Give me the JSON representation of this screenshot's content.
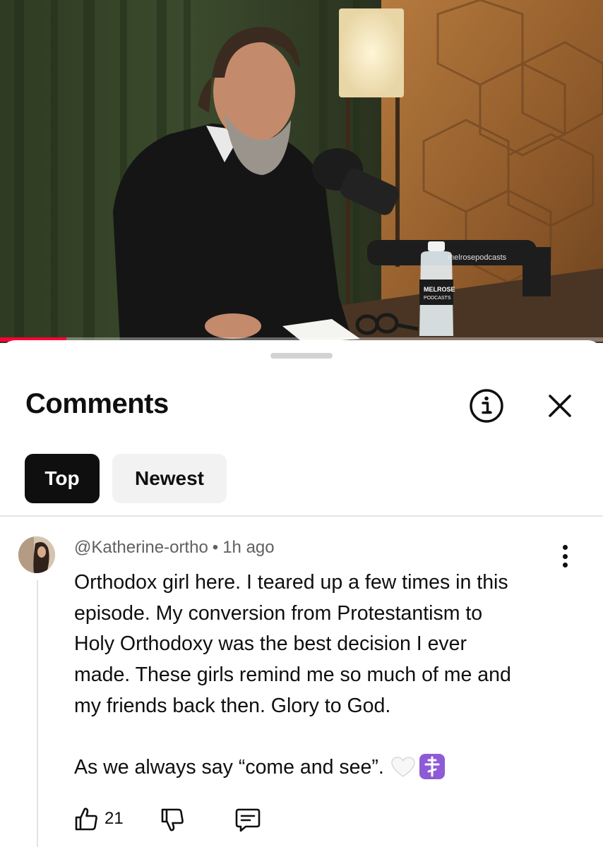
{
  "video": {
    "watermark_text": "melrosepodcasts",
    "bottle_label_line1": "MELROSE",
    "bottle_label_line2": "PODCASTS",
    "progress_fraction": 0.11
  },
  "comments_sheet": {
    "title": "Comments",
    "info_icon": "info-circle-icon",
    "close_icon": "close-icon",
    "filters": [
      {
        "label": "Top",
        "selected": true
      },
      {
        "label": "Newest",
        "selected": false
      }
    ]
  },
  "comment": {
    "author": "@Katherine-ortho",
    "separator": "•",
    "time": "1h ago",
    "lines": [
      "Orthodox girl here. I teared up a few times in this",
      "episode. My conversion from Protestantism to",
      "Holy Orthodoxy was the best decision I ever",
      "made. These girls remind me so much of me and",
      "my friends back then. Glory to God."
    ],
    "closing_line": "As we always say “come and see”.",
    "emojis": [
      "white-heart-icon",
      "orthodox-cross-icon"
    ],
    "like_count": "21",
    "action_icons": [
      "thumbs-up-icon",
      "thumbs-down-icon",
      "reply-icon"
    ],
    "colors": {
      "accent": "#ff0033",
      "chip_selected_bg": "#0f0f0f",
      "chip_bg": "#f2f2f2",
      "meta_text": "#606060",
      "cross_emoji_bg": "#8e5bd6"
    }
  }
}
